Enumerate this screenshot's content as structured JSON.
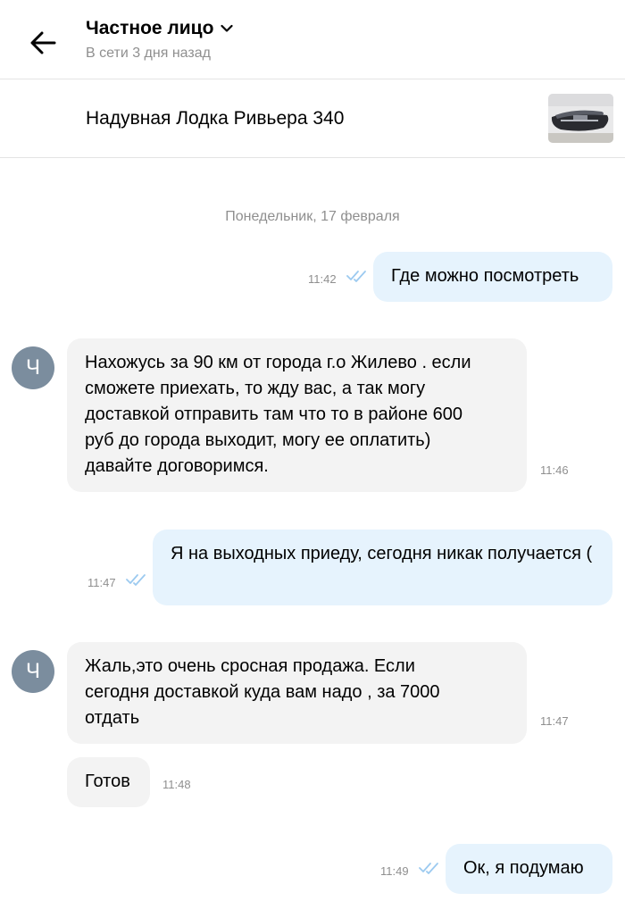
{
  "header": {
    "contact_name": "Частное лицо",
    "status": "В сети 3 дня назад"
  },
  "listing": {
    "title": "Надувная Лодка Ривьера 340"
  },
  "chat": {
    "date_separator": "Понедельник, 17 февраля",
    "avatar_letter": "Ч",
    "messages": [
      {
        "direction": "outgoing",
        "text": "Где можно посмотреть",
        "time": "11:42",
        "read": true
      },
      {
        "direction": "incoming",
        "text": "Нахожусь за 90 км от города г.о Жилево . если сможете приехать, то жду вас, а так могу доставкой отправить там что то в районе 600 руб до города выходит, могу ее оплатить) давайте  договоримся.",
        "time": "11:46"
      },
      {
        "direction": "outgoing",
        "text": "Я на выходных приеду, сегодня никак получается (",
        "time": "11:47",
        "read": true
      },
      {
        "direction": "incoming",
        "text": "Жаль,это очень сросная продажа. Если сегодня доставкой куда вам надо , за 7000 отдать",
        "time": "11:47"
      },
      {
        "direction": "incoming",
        "text": "Готов",
        "time": "11:48"
      },
      {
        "direction": "outgoing",
        "text": "Ок, я подумаю",
        "time": "11:49",
        "read": true
      }
    ]
  },
  "colors": {
    "outgoing_bubble": "#e6f3fd",
    "incoming_bubble": "#f3f3f3",
    "read_check": "#9ccaf0",
    "avatar": "#7b8d9e"
  }
}
